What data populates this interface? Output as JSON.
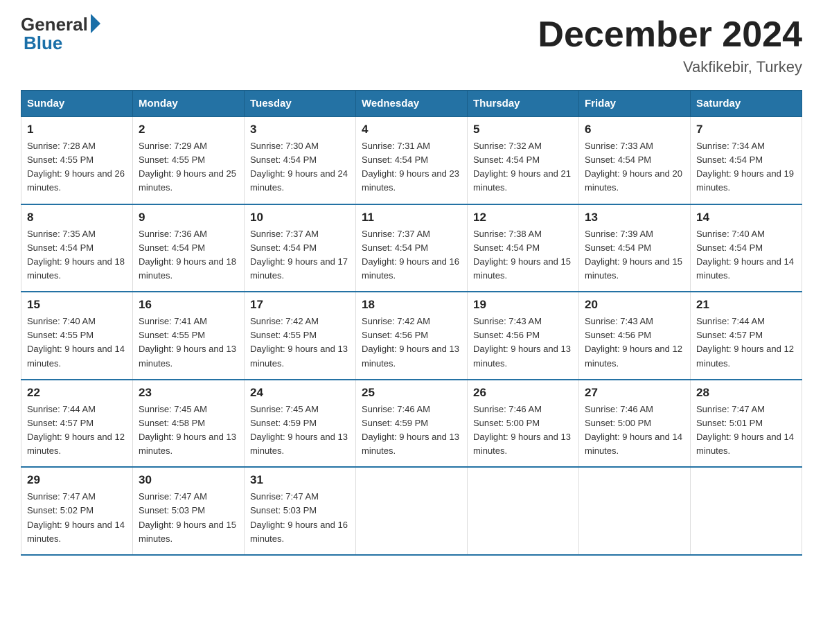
{
  "logo": {
    "general": "General",
    "blue": "Blue"
  },
  "title": "December 2024",
  "subtitle": "Vakfikebir, Turkey",
  "days_of_week": [
    "Sunday",
    "Monday",
    "Tuesday",
    "Wednesday",
    "Thursday",
    "Friday",
    "Saturday"
  ],
  "weeks": [
    [
      {
        "day": "1",
        "sunrise": "Sunrise: 7:28 AM",
        "sunset": "Sunset: 4:55 PM",
        "daylight": "Daylight: 9 hours and 26 minutes."
      },
      {
        "day": "2",
        "sunrise": "Sunrise: 7:29 AM",
        "sunset": "Sunset: 4:55 PM",
        "daylight": "Daylight: 9 hours and 25 minutes."
      },
      {
        "day": "3",
        "sunrise": "Sunrise: 7:30 AM",
        "sunset": "Sunset: 4:54 PM",
        "daylight": "Daylight: 9 hours and 24 minutes."
      },
      {
        "day": "4",
        "sunrise": "Sunrise: 7:31 AM",
        "sunset": "Sunset: 4:54 PM",
        "daylight": "Daylight: 9 hours and 23 minutes."
      },
      {
        "day": "5",
        "sunrise": "Sunrise: 7:32 AM",
        "sunset": "Sunset: 4:54 PM",
        "daylight": "Daylight: 9 hours and 21 minutes."
      },
      {
        "day": "6",
        "sunrise": "Sunrise: 7:33 AM",
        "sunset": "Sunset: 4:54 PM",
        "daylight": "Daylight: 9 hours and 20 minutes."
      },
      {
        "day": "7",
        "sunrise": "Sunrise: 7:34 AM",
        "sunset": "Sunset: 4:54 PM",
        "daylight": "Daylight: 9 hours and 19 minutes."
      }
    ],
    [
      {
        "day": "8",
        "sunrise": "Sunrise: 7:35 AM",
        "sunset": "Sunset: 4:54 PM",
        "daylight": "Daylight: 9 hours and 18 minutes."
      },
      {
        "day": "9",
        "sunrise": "Sunrise: 7:36 AM",
        "sunset": "Sunset: 4:54 PM",
        "daylight": "Daylight: 9 hours and 18 minutes."
      },
      {
        "day": "10",
        "sunrise": "Sunrise: 7:37 AM",
        "sunset": "Sunset: 4:54 PM",
        "daylight": "Daylight: 9 hours and 17 minutes."
      },
      {
        "day": "11",
        "sunrise": "Sunrise: 7:37 AM",
        "sunset": "Sunset: 4:54 PM",
        "daylight": "Daylight: 9 hours and 16 minutes."
      },
      {
        "day": "12",
        "sunrise": "Sunrise: 7:38 AM",
        "sunset": "Sunset: 4:54 PM",
        "daylight": "Daylight: 9 hours and 15 minutes."
      },
      {
        "day": "13",
        "sunrise": "Sunrise: 7:39 AM",
        "sunset": "Sunset: 4:54 PM",
        "daylight": "Daylight: 9 hours and 15 minutes."
      },
      {
        "day": "14",
        "sunrise": "Sunrise: 7:40 AM",
        "sunset": "Sunset: 4:54 PM",
        "daylight": "Daylight: 9 hours and 14 minutes."
      }
    ],
    [
      {
        "day": "15",
        "sunrise": "Sunrise: 7:40 AM",
        "sunset": "Sunset: 4:55 PM",
        "daylight": "Daylight: 9 hours and 14 minutes."
      },
      {
        "day": "16",
        "sunrise": "Sunrise: 7:41 AM",
        "sunset": "Sunset: 4:55 PM",
        "daylight": "Daylight: 9 hours and 13 minutes."
      },
      {
        "day": "17",
        "sunrise": "Sunrise: 7:42 AM",
        "sunset": "Sunset: 4:55 PM",
        "daylight": "Daylight: 9 hours and 13 minutes."
      },
      {
        "day": "18",
        "sunrise": "Sunrise: 7:42 AM",
        "sunset": "Sunset: 4:56 PM",
        "daylight": "Daylight: 9 hours and 13 minutes."
      },
      {
        "day": "19",
        "sunrise": "Sunrise: 7:43 AM",
        "sunset": "Sunset: 4:56 PM",
        "daylight": "Daylight: 9 hours and 13 minutes."
      },
      {
        "day": "20",
        "sunrise": "Sunrise: 7:43 AM",
        "sunset": "Sunset: 4:56 PM",
        "daylight": "Daylight: 9 hours and 12 minutes."
      },
      {
        "day": "21",
        "sunrise": "Sunrise: 7:44 AM",
        "sunset": "Sunset: 4:57 PM",
        "daylight": "Daylight: 9 hours and 12 minutes."
      }
    ],
    [
      {
        "day": "22",
        "sunrise": "Sunrise: 7:44 AM",
        "sunset": "Sunset: 4:57 PM",
        "daylight": "Daylight: 9 hours and 12 minutes."
      },
      {
        "day": "23",
        "sunrise": "Sunrise: 7:45 AM",
        "sunset": "Sunset: 4:58 PM",
        "daylight": "Daylight: 9 hours and 13 minutes."
      },
      {
        "day": "24",
        "sunrise": "Sunrise: 7:45 AM",
        "sunset": "Sunset: 4:59 PM",
        "daylight": "Daylight: 9 hours and 13 minutes."
      },
      {
        "day": "25",
        "sunrise": "Sunrise: 7:46 AM",
        "sunset": "Sunset: 4:59 PM",
        "daylight": "Daylight: 9 hours and 13 minutes."
      },
      {
        "day": "26",
        "sunrise": "Sunrise: 7:46 AM",
        "sunset": "Sunset: 5:00 PM",
        "daylight": "Daylight: 9 hours and 13 minutes."
      },
      {
        "day": "27",
        "sunrise": "Sunrise: 7:46 AM",
        "sunset": "Sunset: 5:00 PM",
        "daylight": "Daylight: 9 hours and 14 minutes."
      },
      {
        "day": "28",
        "sunrise": "Sunrise: 7:47 AM",
        "sunset": "Sunset: 5:01 PM",
        "daylight": "Daylight: 9 hours and 14 minutes."
      }
    ],
    [
      {
        "day": "29",
        "sunrise": "Sunrise: 7:47 AM",
        "sunset": "Sunset: 5:02 PM",
        "daylight": "Daylight: 9 hours and 14 minutes."
      },
      {
        "day": "30",
        "sunrise": "Sunrise: 7:47 AM",
        "sunset": "Sunset: 5:03 PM",
        "daylight": "Daylight: 9 hours and 15 minutes."
      },
      {
        "day": "31",
        "sunrise": "Sunrise: 7:47 AM",
        "sunset": "Sunset: 5:03 PM",
        "daylight": "Daylight: 9 hours and 16 minutes."
      },
      null,
      null,
      null,
      null
    ]
  ]
}
